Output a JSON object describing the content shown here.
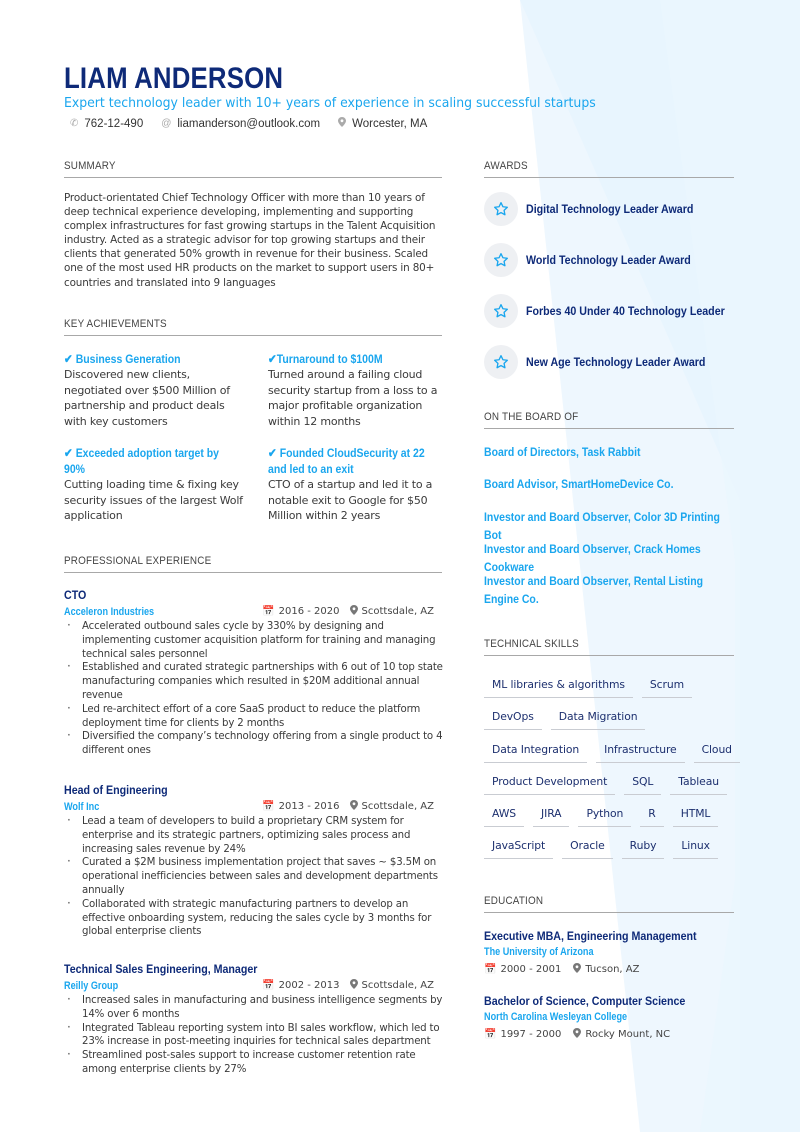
{
  "header": {
    "name": "LIAM ANDERSON",
    "tagline": "Expert technology leader with 10+ years of experience in scaling successful startups",
    "phone": "762-12-490",
    "email": "liamanderson@outlook.com",
    "location": "Worcester, MA"
  },
  "summary": {
    "heading": "SUMMARY",
    "text": "Product-orientated Chief Technology Officer with more than 10 years of deep technical experience developing, implementing and supporting complex infrastructures for fast growing startups in the Talent Acquisition industry. Acted as a strategic advisor for top growing startups and their clients that generated 50% growth in revenue for their business. Scaled one of the most used HR products on the market to support users in 80+ countries and translated into 9 languages"
  },
  "achievements": {
    "heading": "KEY ACHIEVEMENTS",
    "items": [
      {
        "title": "✔ Business Generation",
        "desc": "Discovered new clients, negotiated over $500 Million of partnership and product deals with key customers"
      },
      {
        "title": "✔Turnaround to $100M",
        "desc": "Turned around a failing cloud security startup from a loss to a major profitable organization within 12 months"
      },
      {
        "title": "✔ Exceeded adoption target by 90%",
        "desc": "Cutting loading time & fixing key security issues of the largest Wolf application"
      },
      {
        "title": "✔ Founded CloudSecurity at 22 and led to an exit",
        "desc": "CTO of a startup and led it to a notable exit to Google for $50 Million within 2 years"
      }
    ]
  },
  "experience": {
    "heading": "PROFESSIONAL EXPERIENCE",
    "jobs": [
      {
        "title": "CTO",
        "company": "Acceleron Industries",
        "dates": "2016 - 2020",
        "location": "Scottsdale, AZ",
        "bullets": [
          "Accelerated outbound sales cycle by 330% by designing and implementing customer acquisition platform for training and managing technical sales personnel",
          "Established and curated strategic partnerships with 6 out of 10 top state manufacturing companies which resulted in $20M additional annual revenue",
          "Led re-architect effort of a core SaaS product to reduce the platform deployment time for clients by 2 months",
          "Diversified the company’s technology offering from a single product to 4 different ones"
        ]
      },
      {
        "title": "Head of Engineering",
        "company": "Wolf Inc",
        "dates": "2013 - 2016",
        "location": "Scottsdale, AZ",
        "bullets": [
          "Lead a team of developers to build a proprietary CRM system for enterprise and its strategic partners, optimizing sales process and increasing sales revenue by 24%",
          "Curated a $2M business implementation project that saves ~ $3.5M on operational inefficiencies between sales and development departments annually",
          "Collaborated with strategic manufacturing partners to develop an effective onboarding system, reducing the sales cycle by 3 months for global enterprise clients"
        ]
      },
      {
        "title": "Technical Sales Engineering, Manager",
        "company": "Reilly Group",
        "dates": "2002 - 2013",
        "location": "Scottsdale, AZ",
        "bullets": [
          "Increased sales in manufacturing and business intelligence segments by 14% over 6 months",
          "Integrated Tableau reporting system into BI sales workflow, which led to 23% increase in post-meeting inquiries for technical sales department",
          "Streamlined post-sales support to increase customer retention rate among enterprise clients by 27%"
        ]
      }
    ]
  },
  "awards": {
    "heading": "AWARDS",
    "items": [
      "Digital Technology Leader Award",
      "World Technology Leader Award",
      "Forbes 40 Under 40 Technology Leader",
      "New Age Technology Leader Award"
    ]
  },
  "board": {
    "heading": "ON THE BOARD OF",
    "items": [
      "Board of Directors, Task Rabbit",
      "Board Advisor, SmartHomeDevice Co.",
      "Investor and Board Observer, Color 3D Printing Bot",
      "Investor and Board Observer, Crack Homes Cookware",
      "Investor and Board Observer, Rental Listing Engine Co."
    ]
  },
  "skills": {
    "heading": "TECHNICAL SKILLS",
    "rows": [
      [
        "ML libraries & algorithms",
        "Scrum"
      ],
      [
        "DevOps",
        "Data Migration"
      ],
      [
        "Data Integration",
        "Infrastructure",
        "Cloud"
      ],
      [
        "Product Development",
        "SQL",
        "Tableau"
      ],
      [
        "AWS",
        "JIRA",
        "Python",
        "R",
        "HTML"
      ],
      [
        "JavaScript",
        "Oracle",
        "Ruby",
        "Linux"
      ]
    ]
  },
  "education": {
    "heading": "EDUCATION",
    "items": [
      {
        "degree": "Executive MBA, Engineering Management",
        "school": "The University of Arizona",
        "dates": "2000 - 2001",
        "location": "Tucson, AZ"
      },
      {
        "degree": "Bachelor of Science, Computer Science",
        "school": "North Carolina Wesleyan College",
        "dates": "1997 - 2000",
        "location": "Rocky Mount, NC"
      }
    ]
  },
  "colors": {
    "navy": "#0e2a78",
    "accent": "#1aa6ee",
    "background_tint": "#e8f4fd"
  }
}
